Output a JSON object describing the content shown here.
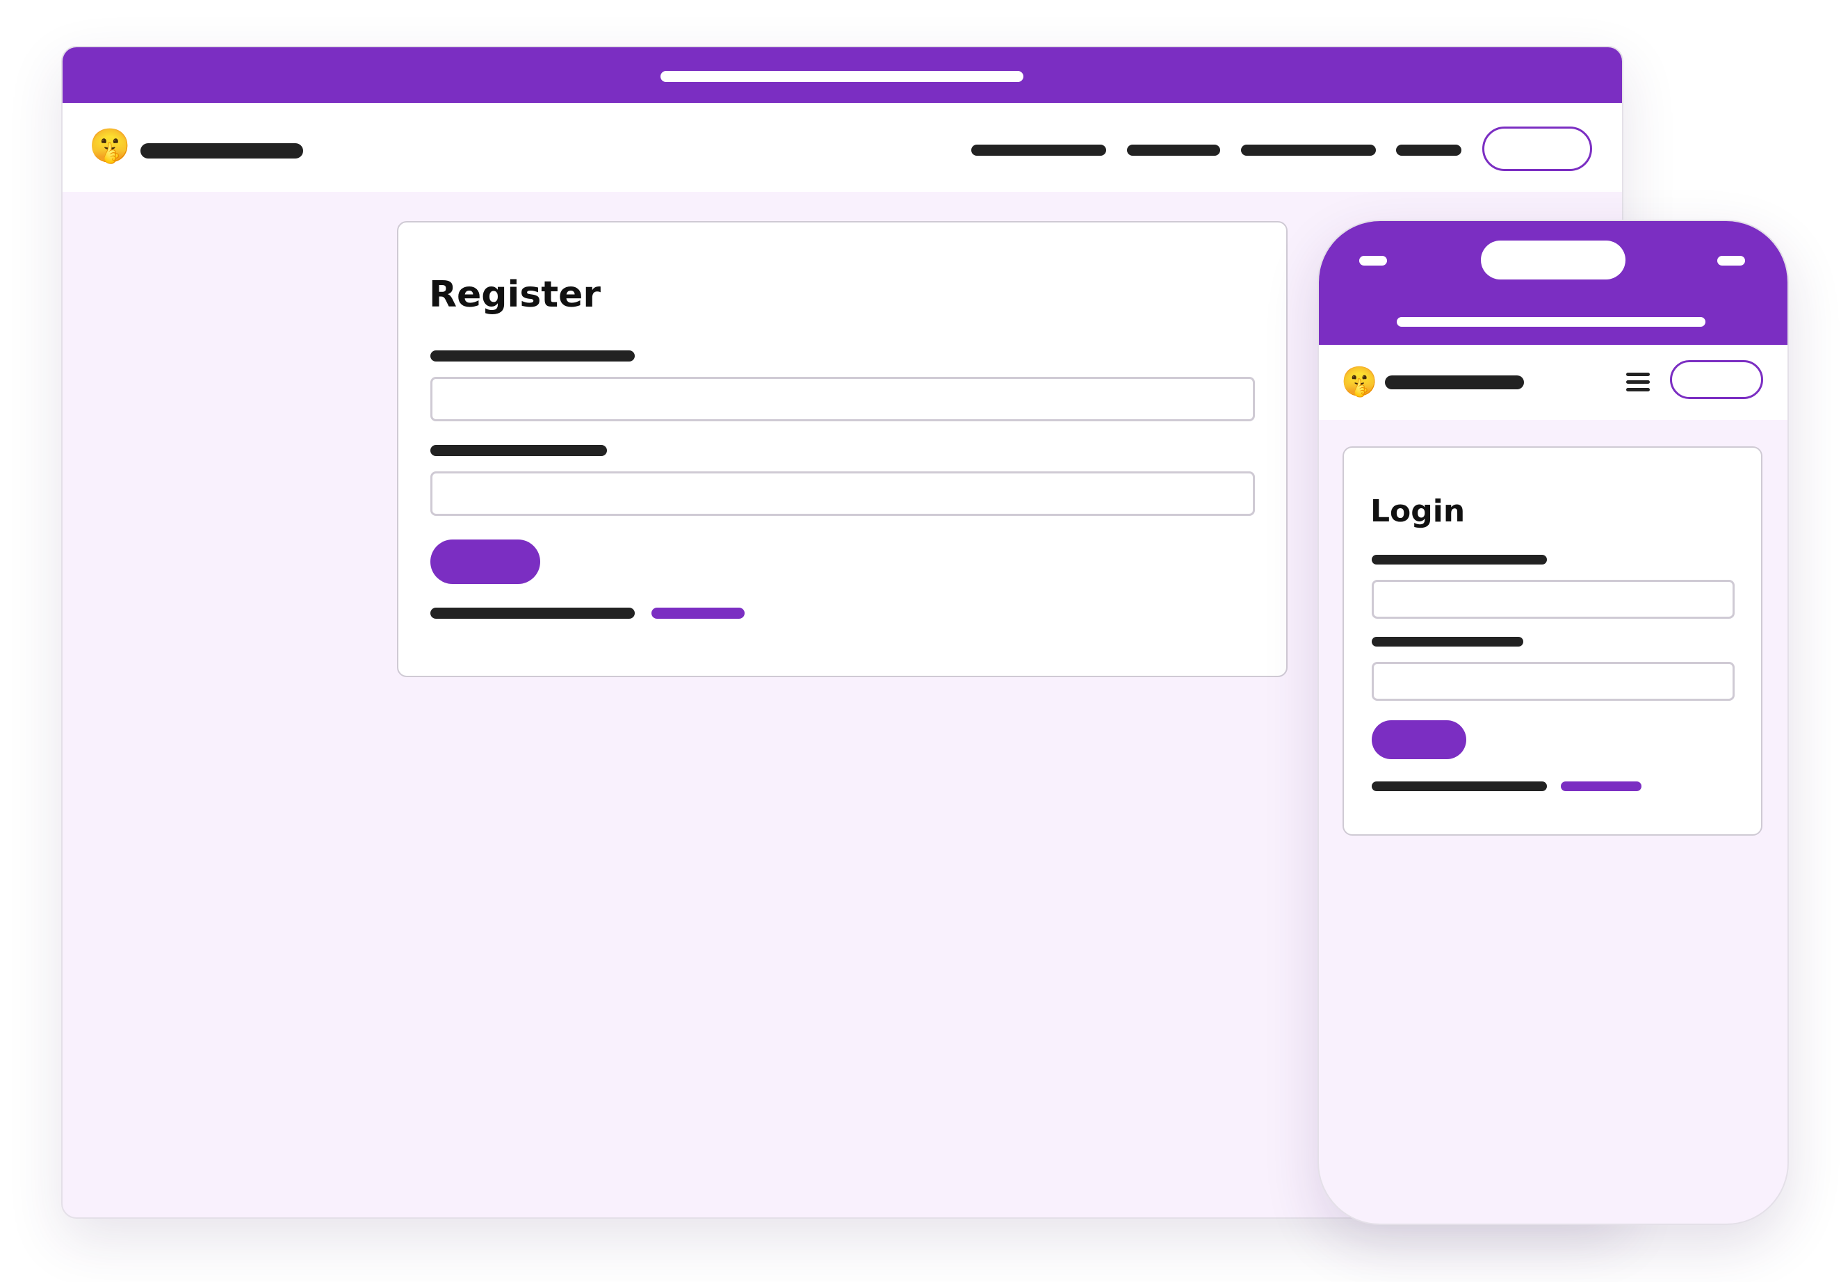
{
  "desktop": {
    "logo_emoji": "🤫",
    "register_card": {
      "title": "Register"
    }
  },
  "mobile": {
    "logo_emoji": "🤫",
    "menu_icon": "hamburger-menu-icon",
    "login_card": {
      "title": "Login"
    }
  },
  "colors": {
    "accent": "#7b2ec2",
    "page_background": "#f9f1fd",
    "placeholder_bar": "#222222",
    "input_border": "#cfcad4"
  }
}
